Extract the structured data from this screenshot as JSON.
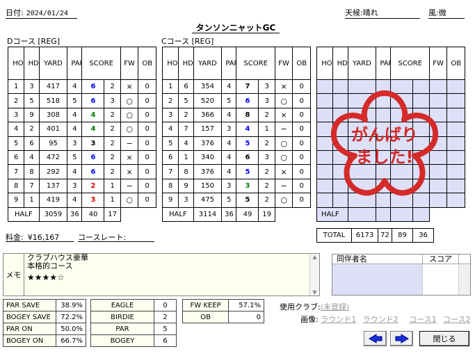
{
  "header": {
    "date_label": "日付:",
    "date": "2024/01/24",
    "weather_label": "天候:",
    "weather": "晴れ",
    "wind_label": "風:",
    "wind": "微",
    "course_name": "タンソンニャットGC"
  },
  "columns": {
    "hole": "HOLE",
    "hdcp": "HDCP",
    "yard": "YARD",
    "par": "PAR",
    "score": "SCORE",
    "fw": "FW",
    "ob": "OB"
  },
  "front": {
    "title": "Dコース [REG]",
    "rows": [
      {
        "hole": "1",
        "hdcp": "3",
        "yard": "417",
        "par": "4",
        "score": "6",
        "putt": "2",
        "fw": "×",
        "ob": "0",
        "c": "blue"
      },
      {
        "hole": "2",
        "hdcp": "5",
        "yard": "518",
        "par": "5",
        "score": "6",
        "putt": "3",
        "fw": "○",
        "ob": "0",
        "c": "blue"
      },
      {
        "hole": "3",
        "hdcp": "9",
        "yard": "308",
        "par": "4",
        "score": "4",
        "putt": "2",
        "fw": "○",
        "ob": "0",
        "c": "green"
      },
      {
        "hole": "4",
        "hdcp": "2",
        "yard": "401",
        "par": "4",
        "score": "4",
        "putt": "2",
        "fw": "○",
        "ob": "0",
        "c": "green"
      },
      {
        "hole": "5",
        "hdcp": "6",
        "yard": "95",
        "par": "3",
        "score": "3",
        "putt": "2",
        "fw": "−",
        "ob": "0",
        "c": "blk"
      },
      {
        "hole": "6",
        "hdcp": "4",
        "yard": "472",
        "par": "5",
        "score": "6",
        "putt": "2",
        "fw": "×",
        "ob": "0",
        "c": "blue"
      },
      {
        "hole": "7",
        "hdcp": "8",
        "yard": "292",
        "par": "4",
        "score": "6",
        "putt": "2",
        "fw": "×",
        "ob": "0",
        "c": "blue"
      },
      {
        "hole": "8",
        "hdcp": "7",
        "yard": "137",
        "par": "3",
        "score": "2",
        "putt": "1",
        "fw": "−",
        "ob": "0",
        "c": "red"
      },
      {
        "hole": "9",
        "hdcp": "1",
        "yard": "419",
        "par": "4",
        "score": "3",
        "putt": "1",
        "fw": "○",
        "ob": "0",
        "c": "red"
      }
    ],
    "half": {
      "label": "HALF",
      "yard": "3059",
      "par": "36",
      "score": "40",
      "putt": "17"
    }
  },
  "back": {
    "title": "Cコース [REG]",
    "rows": [
      {
        "hole": "1",
        "hdcp": "6",
        "yard": "354",
        "par": "4",
        "score": "7",
        "putt": "3",
        "fw": "×",
        "ob": "0",
        "c": "blk"
      },
      {
        "hole": "2",
        "hdcp": "5",
        "yard": "520",
        "par": "5",
        "score": "6",
        "putt": "3",
        "fw": "○",
        "ob": "0",
        "c": "blue"
      },
      {
        "hole": "3",
        "hdcp": "2",
        "yard": "366",
        "par": "4",
        "score": "8",
        "putt": "2",
        "fw": "×",
        "ob": "0",
        "c": "blk"
      },
      {
        "hole": "4",
        "hdcp": "7",
        "yard": "157",
        "par": "3",
        "score": "4",
        "putt": "1",
        "fw": "−",
        "ob": "0",
        "c": "blue"
      },
      {
        "hole": "5",
        "hdcp": "4",
        "yard": "376",
        "par": "4",
        "score": "5",
        "putt": "2",
        "fw": "○",
        "ob": "0",
        "c": "blue"
      },
      {
        "hole": "6",
        "hdcp": "1",
        "yard": "340",
        "par": "4",
        "score": "6",
        "putt": "3",
        "fw": "○",
        "ob": "0",
        "c": "blk"
      },
      {
        "hole": "7",
        "hdcp": "8",
        "yard": "376",
        "par": "4",
        "score": "5",
        "putt": "2",
        "fw": "×",
        "ob": "0",
        "c": "blue"
      },
      {
        "hole": "8",
        "hdcp": "9",
        "yard": "150",
        "par": "3",
        "score": "3",
        "putt": "2",
        "fw": "−",
        "ob": "0",
        "c": "green"
      },
      {
        "hole": "9",
        "hdcp": "3",
        "yard": "475",
        "par": "5",
        "score": "5",
        "putt": "2",
        "fw": "○",
        "ob": "0",
        "c": "blk"
      }
    ],
    "half": {
      "label": "HALF",
      "yard": "3114",
      "par": "36",
      "score": "49",
      "putt": "19"
    }
  },
  "third": {
    "half_label": "HALF",
    "total_label": "TOTAL",
    "total_yard": "6173",
    "total_par": "72",
    "total_score": "89",
    "total_putt": "36"
  },
  "stamp": {
    "line1": "がんばり",
    "line2": "ました!",
    "color": "#d42a2a"
  },
  "fee": {
    "label": "料金:",
    "value": "¥16,167",
    "rate_label": "コースレート:",
    "rate_value": ""
  },
  "memo": {
    "label": "メモ",
    "line1": "クラブハウス豪華",
    "line2": "本格的コース",
    "stars": "★★★★☆"
  },
  "companions": {
    "name_header": "同伴者名",
    "score_header": "スコア"
  },
  "stats": [
    {
      "label": "PAR SAVE",
      "value": "38.9%"
    },
    {
      "label": "BOGEY SAVE",
      "value": "72.2%"
    },
    {
      "label": "PAR ON",
      "value": "50.0%"
    },
    {
      "label": "BOGEY ON",
      "value": "66.7%"
    }
  ],
  "counts": [
    {
      "label": "EAGLE",
      "value": "0"
    },
    {
      "label": "BIRDIE",
      "value": "2"
    },
    {
      "label": "PAR",
      "value": "5"
    },
    {
      "label": "BOGEY",
      "value": "6"
    }
  ],
  "fw": [
    {
      "label": "FW KEEP",
      "value": "57.1%"
    },
    {
      "label": "OB",
      "value": "0"
    }
  ],
  "clubs": {
    "label": "使用クラブ:",
    "value": "(未登録)"
  },
  "images": {
    "label": "画像:",
    "round1": "ラウンド1",
    "round2": "ラウンド2",
    "course1": "コース1",
    "course2": "コース2"
  },
  "buttons": {
    "close": "閉じる"
  },
  "colors": {
    "score_blue": "#0000ff",
    "score_red": "#e00000",
    "score_green": "#008000",
    "header_border": "#00008b",
    "grid_bg": "#dde0f6"
  }
}
